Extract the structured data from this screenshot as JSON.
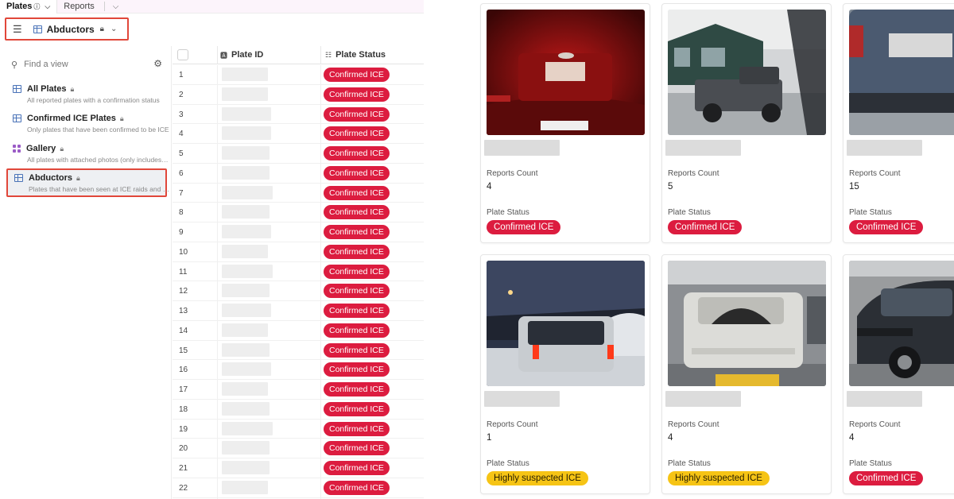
{
  "tabs": [
    {
      "label": "Plates",
      "active": true
    },
    {
      "label": "Reports",
      "active": false
    }
  ],
  "current_view": {
    "name": "Abductors"
  },
  "sidebar": {
    "search_placeholder": "Find a view",
    "views": [
      {
        "name": "All Plates",
        "desc": "All reported plates with a confirmation status",
        "icon": "grid-icon",
        "selected": false
      },
      {
        "name": "Confirmed ICE Plates",
        "desc": "Only plates that have been confirmed to be ICE",
        "icon": "grid-icon",
        "selected": false
      },
      {
        "name": "Gallery",
        "desc": "All plates with attached photos (only includes photos)",
        "icon": "gallery-icon",
        "selected": false
      },
      {
        "name": "Abductors",
        "desc": "Plates that have been seen at ICE raids and abductions",
        "icon": "grid-icon",
        "selected": true
      }
    ]
  },
  "grid": {
    "columns": [
      "Plate ID",
      "Plate Status"
    ],
    "rows": [
      {
        "num": "1",
        "status": "Confirmed ICE"
      },
      {
        "num": "2",
        "status": "Confirmed ICE"
      },
      {
        "num": "3",
        "status": "Confirmed ICE"
      },
      {
        "num": "4",
        "status": "Confirmed ICE"
      },
      {
        "num": "5",
        "status": "Confirmed ICE"
      },
      {
        "num": "6",
        "status": "Confirmed ICE"
      },
      {
        "num": "7",
        "status": "Confirmed ICE"
      },
      {
        "num": "8",
        "status": "Confirmed ICE"
      },
      {
        "num": "9",
        "status": "Confirmed ICE"
      },
      {
        "num": "10",
        "status": "Confirmed ICE"
      },
      {
        "num": "11",
        "status": "Confirmed ICE"
      },
      {
        "num": "12",
        "status": "Confirmed ICE"
      },
      {
        "num": "13",
        "status": "Confirmed ICE"
      },
      {
        "num": "14",
        "status": "Confirmed ICE"
      },
      {
        "num": "15",
        "status": "Confirmed ICE"
      },
      {
        "num": "16",
        "status": "Confirmed ICE"
      },
      {
        "num": "17",
        "status": "Confirmed ICE"
      },
      {
        "num": "18",
        "status": "Confirmed ICE"
      },
      {
        "num": "19",
        "status": "Confirmed ICE"
      },
      {
        "num": "20",
        "status": "Confirmed ICE"
      },
      {
        "num": "21",
        "status": "Confirmed ICE"
      },
      {
        "num": "22",
        "status": "Confirmed ICE"
      }
    ]
  },
  "gallery": {
    "field_labels": {
      "count": "Reports Count",
      "status": "Plate Status"
    },
    "cards": [
      {
        "count": "4",
        "status": "Confirmed ICE",
        "status_color": "#dc1c3f",
        "photo": "night-tailgate"
      },
      {
        "count": "5",
        "status": "Confirmed ICE",
        "status_color": "#dc1c3f",
        "photo": "gray-pickup"
      },
      {
        "count": "15",
        "status": "Confirmed ICE",
        "status_color": "#dc1c3f",
        "photo": "blue-suv"
      },
      {
        "count": "1",
        "status": "Highly suspected ICE",
        "status_color": "#f6c415",
        "photo": "white-suv-night"
      },
      {
        "count": "4",
        "status": "Highly suspected ICE",
        "status_color": "#f6c415",
        "photo": "frosted-suv-garage"
      },
      {
        "count": "4",
        "status": "Confirmed ICE",
        "status_color": "#dc1c3f",
        "photo": "black-suv"
      }
    ]
  },
  "colors": {
    "accent_red": "#dc1c3f",
    "highlight_border": "#e1473a",
    "suspected_yellow": "#f6c415"
  }
}
